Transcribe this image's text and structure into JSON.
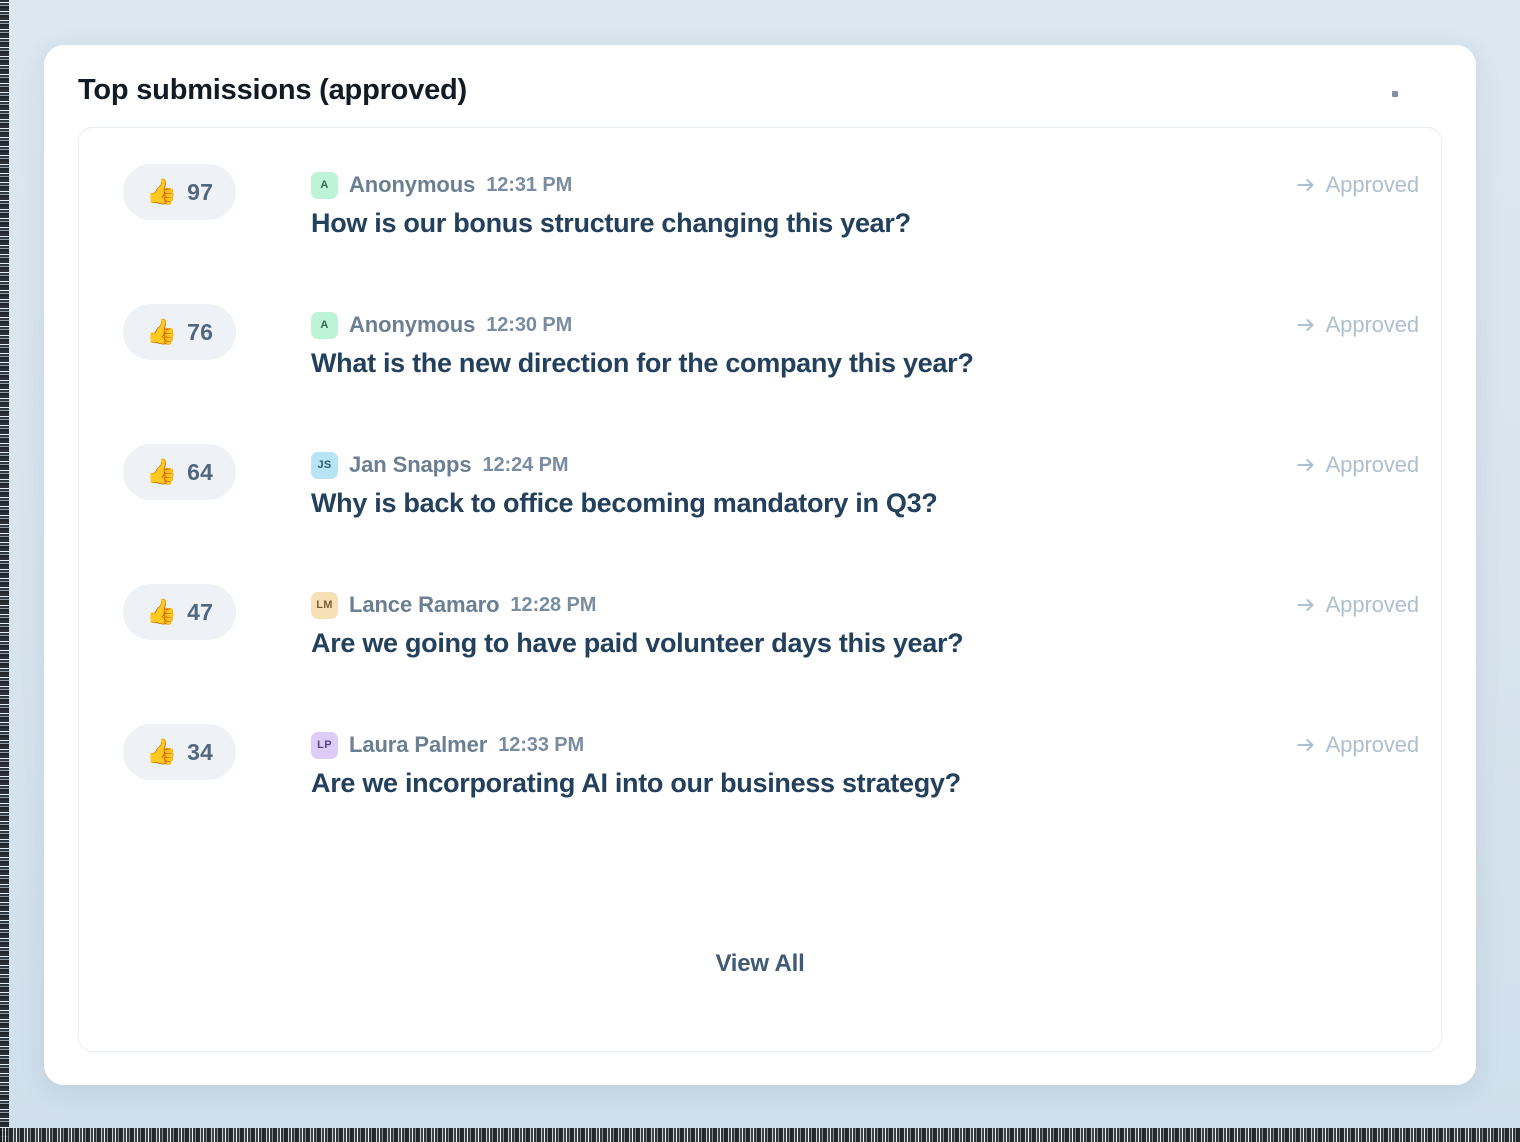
{
  "page": {
    "background_color": "#d9e5ee",
    "card_background": "#ffffff"
  },
  "header": {
    "title": "Top submissions (approved)",
    "menu_dot": "·"
  },
  "colors": {
    "question_text": "#23405c",
    "author_text": "#6b7f93",
    "status_text": "#aebfd0",
    "vote_pill_bg": "#eef2f7",
    "vote_count_text": "#51677d",
    "panel_border": "#e7eef4"
  },
  "submissions": [
    {
      "votes": "97",
      "thumb_icon": "thumbs-up",
      "avatar_initials": "A",
      "avatar_bg": "#bdf3d6",
      "avatar_text_color": "#2f6b4c",
      "author": "Anonymous",
      "time": "12:31 PM",
      "question": "How is our bonus structure changing this year?",
      "status": "Approved",
      "status_icon": "arrow-right-icon"
    },
    {
      "votes": "76",
      "thumb_icon": "thumbs-up",
      "avatar_initials": "A",
      "avatar_bg": "#bdf3d6",
      "avatar_text_color": "#2f6b4c",
      "author": "Anonymous",
      "time": "12:30 PM",
      "question": "What is the new direction for the company this year?",
      "status": "Approved",
      "status_icon": "arrow-right-icon"
    },
    {
      "votes": "64",
      "thumb_icon": "thumbs-up",
      "avatar_initials": "JS",
      "avatar_bg": "#b8e4f5",
      "avatar_text_color": "#2b5c73",
      "author": "Jan Snapps",
      "time": "12:24 PM",
      "question": "Why is back to office becoming mandatory in Q3?",
      "status": "Approved",
      "status_icon": "arrow-right-icon"
    },
    {
      "votes": "47",
      "thumb_icon": "thumbs-up",
      "avatar_initials": "LM",
      "avatar_bg": "#f7e0b5",
      "avatar_text_color": "#7a6032",
      "author": "Lance Ramaro",
      "time": "12:28 PM",
      "question": "Are we going to have paid volunteer days this year?",
      "status": "Approved",
      "status_icon": "arrow-right-icon"
    },
    {
      "votes": "34",
      "thumb_icon": "thumbs-up",
      "avatar_initials": "LP",
      "avatar_bg": "#ddccf7",
      "avatar_text_color": "#5a4488",
      "author": "Laura Palmer",
      "time": "12:33 PM",
      "question": "Are we incorporating AI into our business strategy?",
      "status": "Approved",
      "status_icon": "arrow-right-icon"
    }
  ],
  "footer": {
    "view_all_label": "View All"
  }
}
